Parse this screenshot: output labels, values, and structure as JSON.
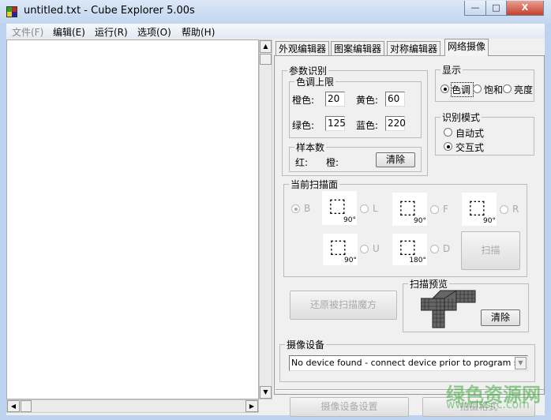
{
  "window": {
    "title": "untitled.txt - Cube Explorer 5.00s",
    "minimize": "—",
    "maximize": "□",
    "close": "X"
  },
  "menu": [
    {
      "label": "文件(F)",
      "disabled": true
    },
    {
      "label": "编辑(E)"
    },
    {
      "label": "运行(R)"
    },
    {
      "label": "选项(O)"
    },
    {
      "label": "帮助(H)"
    }
  ],
  "tabs": [
    "外观编辑器",
    "图案编辑器",
    "对称编辑器",
    "网络摄像"
  ],
  "params": {
    "title": "参数识别",
    "hue_limit": "色调上限",
    "orange_label": "橙色:",
    "orange": "20",
    "yellow_label": "黄色:",
    "yellow": "60",
    "green_label": "绿色:",
    "green": "125",
    "blue_label": "蓝色:",
    "blue": "220",
    "samples": "样本数",
    "red_label": "红:",
    "orange_count_label": "橙:",
    "clear": "清除"
  },
  "display": {
    "title": "显示",
    "options": [
      "色调",
      "饱和",
      "亮度"
    ],
    "selected": 0
  },
  "mode": {
    "title": "识别模式",
    "options": [
      "自动式",
      "交互式"
    ],
    "selected": 1
  },
  "scan": {
    "title": "当前扫描面",
    "faces": [
      "B",
      "L",
      "F",
      "R",
      "U",
      "D"
    ],
    "selected": "B",
    "angles": [
      "90°",
      "90°",
      "90°",
      "90°",
      "180°"
    ],
    "scan_button": "扫描"
  },
  "restore_button": "还原被扫描魔方",
  "preview": {
    "title": "扫描预览",
    "clear": "清除"
  },
  "camera": {
    "title": "摄像设备",
    "device": "No device found - connect device prior to program start!"
  },
  "bottom": {
    "settings": "摄像设备设置",
    "format": "拍摄格式"
  },
  "watermark": {
    "name": "绿色资源网",
    "url": "www.lsscc.com"
  }
}
